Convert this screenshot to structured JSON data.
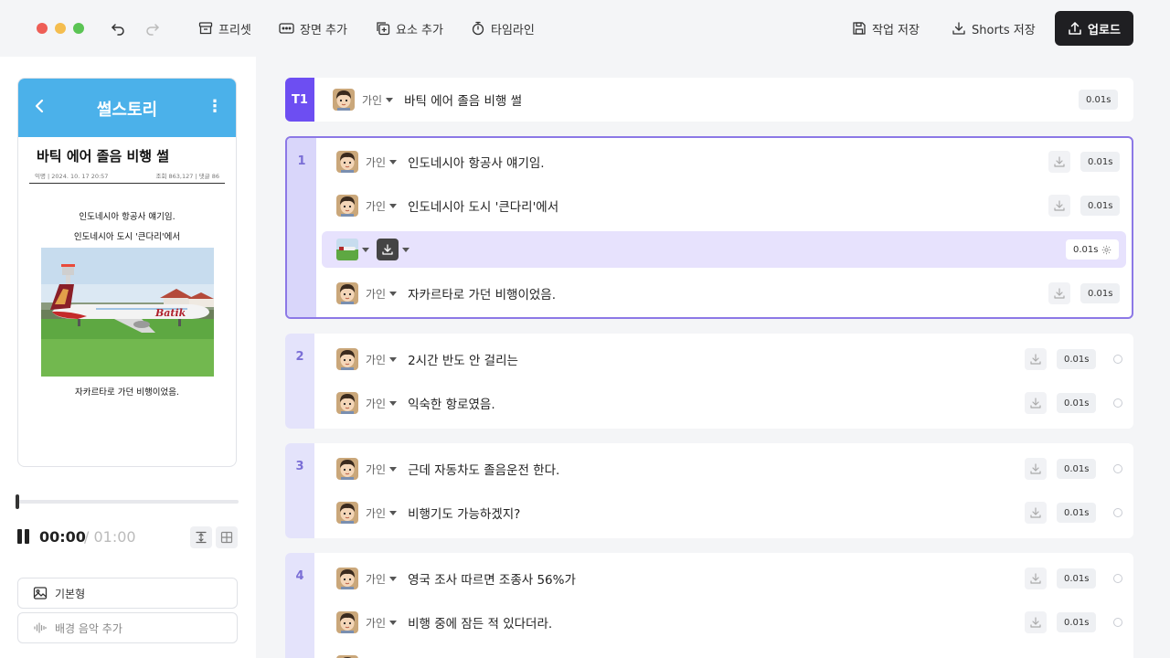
{
  "toolbar": {
    "preset": "프리셋",
    "add_scene": "장면 추가",
    "add_element": "요소 추가",
    "timeline": "타임라인",
    "save_work": "작업 저장",
    "save_shorts": "Shorts 저장",
    "upload": "업로드"
  },
  "preview": {
    "app_title": "썰스토리",
    "post_title": "바틱 에어 졸음 비행 썰",
    "meta_left": "익명 | 2024. 10. 17 20:57",
    "meta_right": "조회 863,127 | 댓글 86",
    "line1": "인도네시아 항공사 얘기임.",
    "line2": "인도네시아 도시 '큰다리'에서",
    "line3": "자카르타로 가던 비행이었음.",
    "plane_brand": "Batik"
  },
  "player": {
    "current": "00:00",
    "total": "/ 01:00",
    "progress": 0.0
  },
  "options": {
    "basic": "기본형",
    "bgm": "배경 음악 추가"
  },
  "timeline": {
    "title_row": {
      "label": "T1",
      "speaker": "가인",
      "text": "바틱 에어 졸음 비행 썰",
      "duration": "0.01s"
    },
    "scenes": [
      {
        "num": "1",
        "rows": [
          {
            "speaker": "가인",
            "text": "인도네시아 항공사 얘기임.",
            "duration": "0.01s"
          },
          {
            "speaker": "가인",
            "text": "인도네시아 도시 '큰다리'에서",
            "duration": "0.01s"
          },
          {
            "image_duration": "0.01s"
          },
          {
            "speaker": "가인",
            "text": "자카르타로 가던 비행이었음.",
            "duration": "0.01s"
          }
        ]
      },
      {
        "num": "2",
        "rows": [
          {
            "speaker": "가인",
            "text": "2시간 반도 안 걸리는",
            "duration": "0.01s"
          },
          {
            "speaker": "가인",
            "text": "익숙한 항로였음.",
            "duration": "0.01s"
          }
        ]
      },
      {
        "num": "3",
        "rows": [
          {
            "speaker": "가인",
            "text": "근데 자동차도 졸음운전 한다.",
            "duration": "0.01s"
          },
          {
            "speaker": "가인",
            "text": "비행기도 가능하겠지?",
            "duration": "0.01s"
          }
        ]
      },
      {
        "num": "4",
        "rows": [
          {
            "speaker": "가인",
            "text": "영국 조사 따르면 조종사 56%가",
            "duration": "0.01s"
          },
          {
            "speaker": "가인",
            "text": "비행 중에 잠든 적 있다더라.",
            "duration": "0.01s"
          }
        ]
      }
    ]
  },
  "colors": {
    "accent": "#6d4ef2",
    "preview_header": "#4bb1ea",
    "upload_bg": "#1f1f22"
  }
}
